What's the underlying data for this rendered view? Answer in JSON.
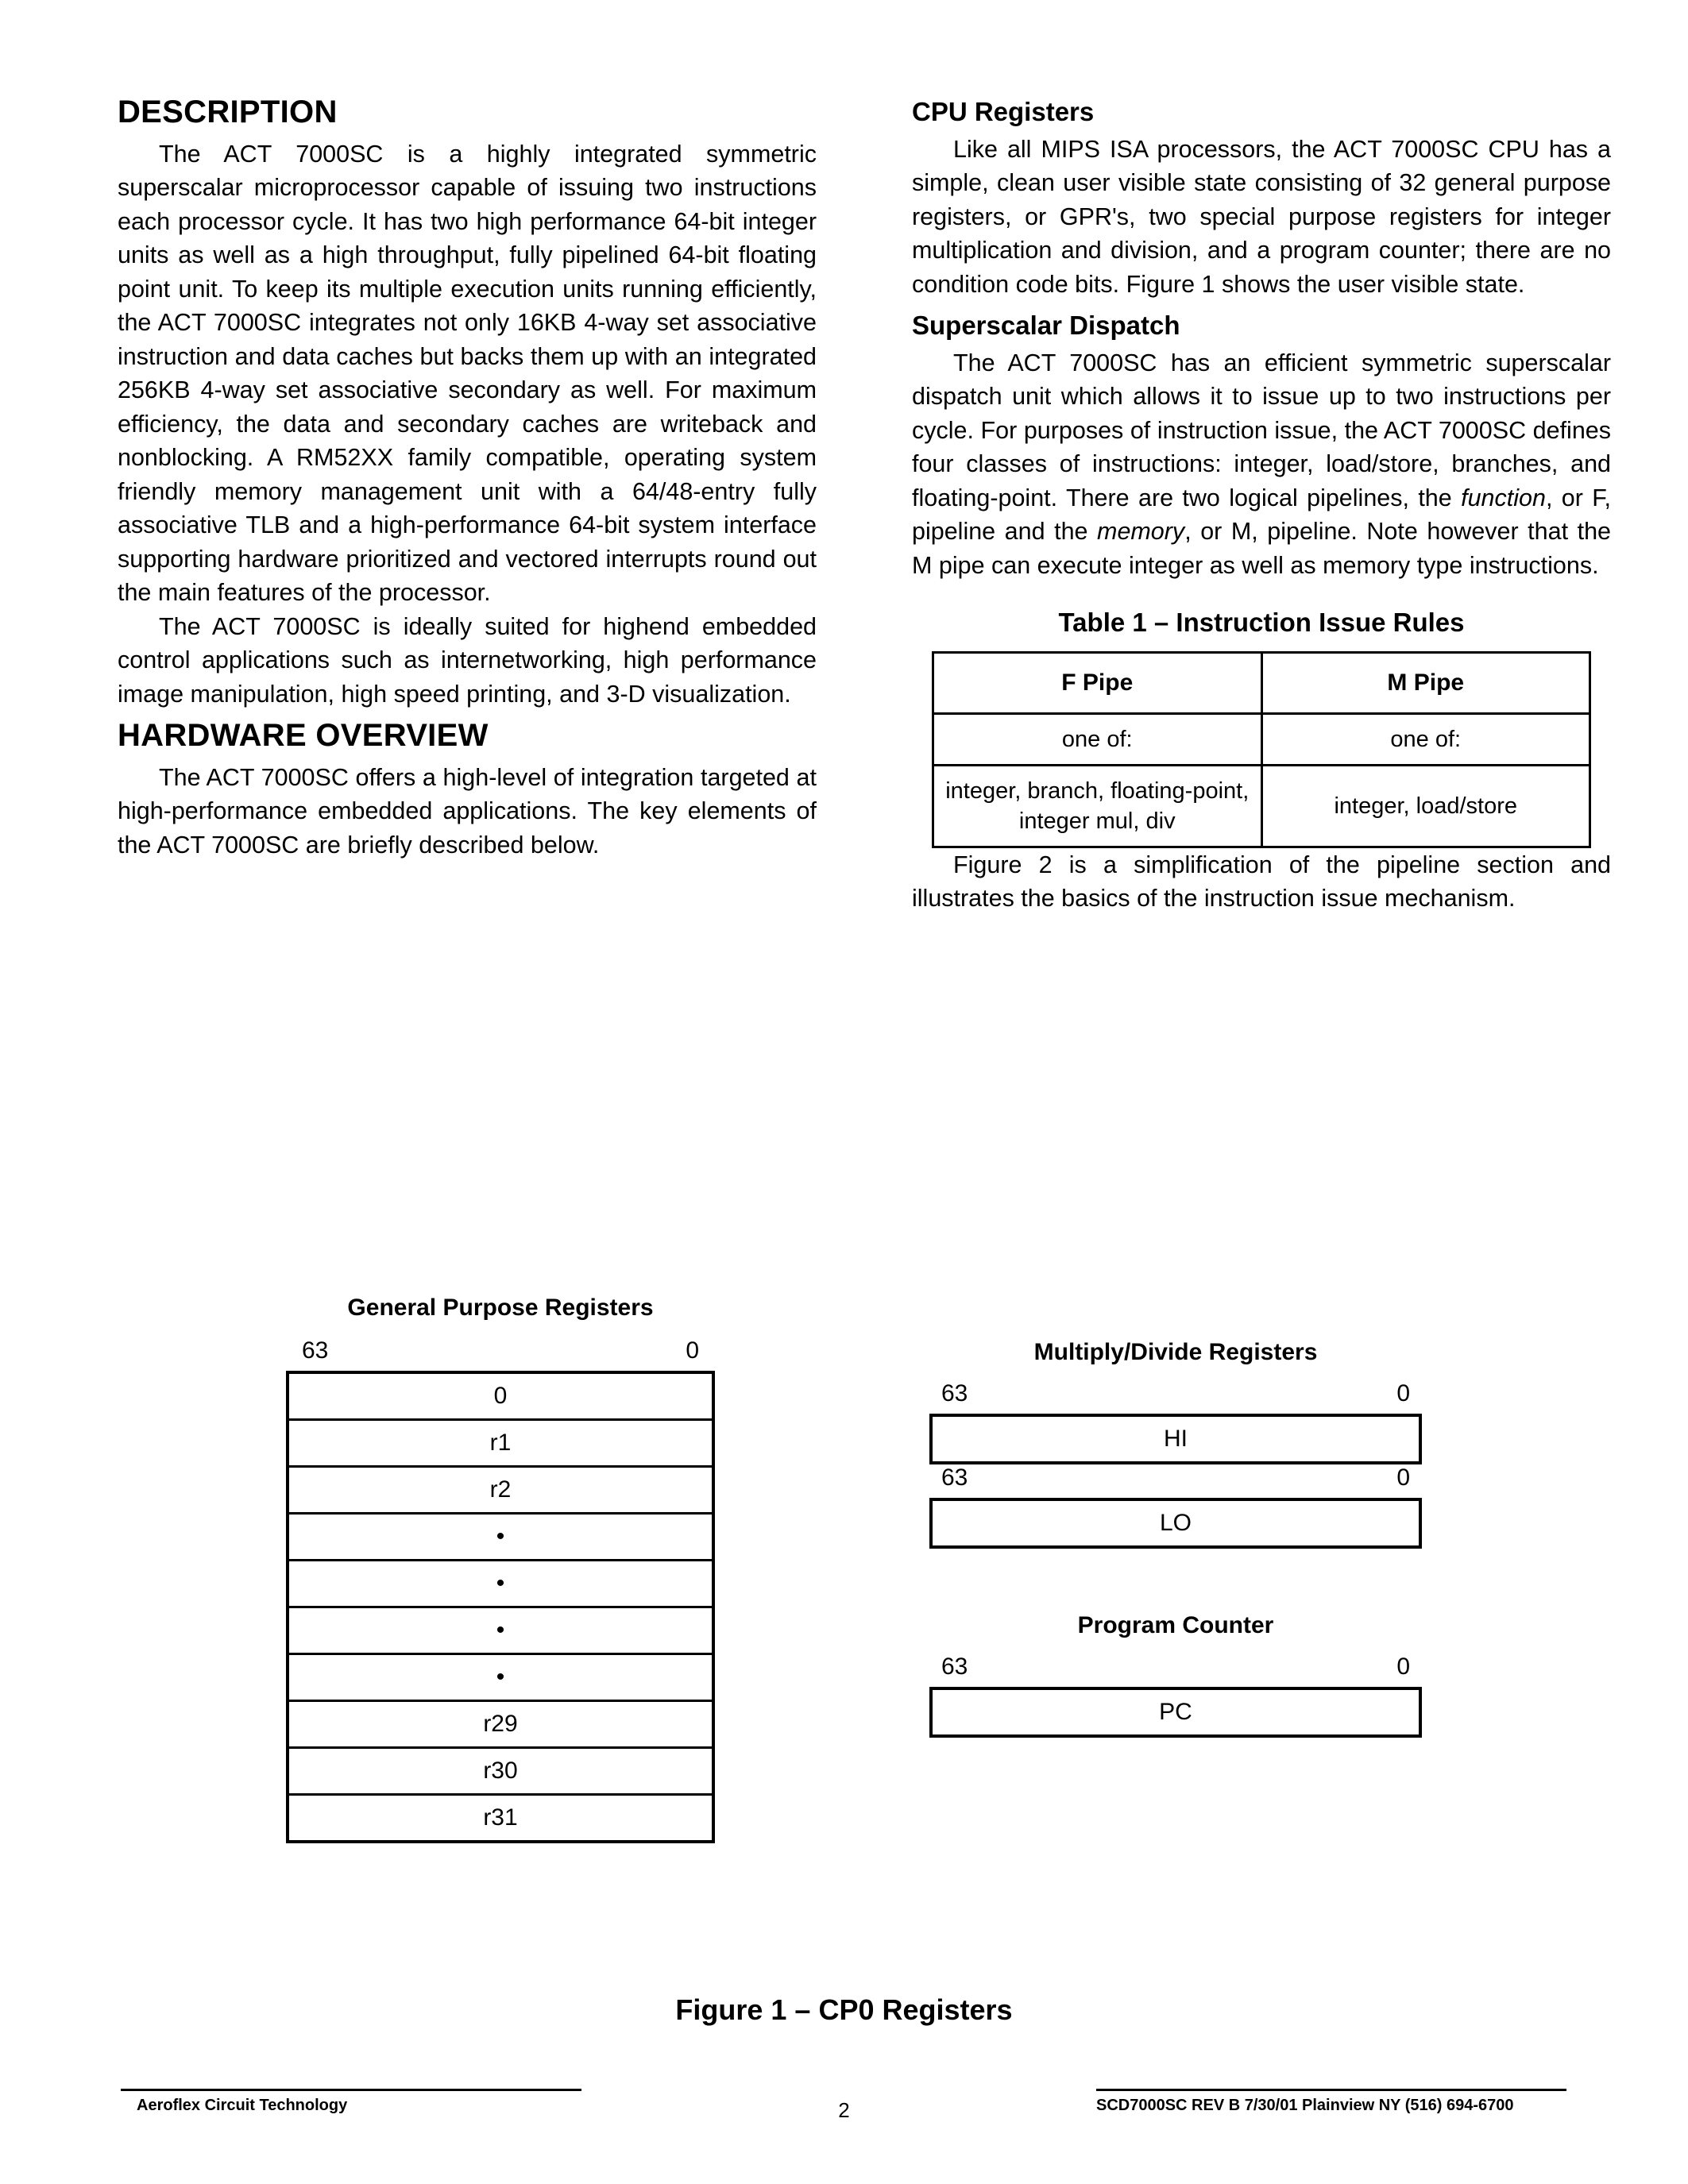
{
  "left_column": {
    "heading1": "DESCRIPTION",
    "para1": "The ACT 7000SC is a highly integrated symmetric superscalar microprocessor capable of issuing two instructions each processor cycle. It has two high performance 64-bit integer units as well as a high throughput, fully pipelined 64-bit floating point unit. To keep its multiple execution units running efficiently, the ACT 7000SC integrates not only 16KB 4-way set associative instruction and data caches but backs them up with an integrated 256KB 4-way set associative secondary as well. For maximum efficiency, the data and secondary caches are writeback and nonblocking. A RM52XX family compatible, operating system friendly memory management unit with a 64/48-entry fully associative TLB and a high-performance 64-bit system interface supporting hardware prioritized and vectored interrupts round out the main features of the processor.",
    "para2": "The ACT 7000SC is ideally suited for highend embedded control applications such as internetworking, high performance image manipulation, high speed printing, and 3-D visualization.",
    "heading2": "HARDWARE OVERVIEW",
    "para3": "The ACT 7000SC offers a high-level of integration targeted at high-performance embedded applications. The key elements of the ACT 7000SC are briefly described below."
  },
  "right_column": {
    "heading1": "CPU Registers",
    "para1": "Like all MIPS ISA processors, the ACT 7000SC CPU has a simple, clean user visible state consisting of 32 general purpose registers, or GPR's, two special purpose registers for integer multiplication and division, and a program counter; there are no condition code bits. Figure 1 shows the user visible state.",
    "heading2": "Superscalar Dispatch",
    "para2_a": "The ACT 7000SC has an efficient symmetric superscalar dispatch unit which allows it to issue up to two instructions per cycle. For purposes of instruction issue, the ACT 7000SC defines four classes of instructions: integer, load/store, branches, and floating-point. There are two logical pipelines, the ",
    "para2_em1": "function",
    "para2_b": ", or F, pipeline and the ",
    "para2_em2": "memory",
    "para2_c": ", or M, pipeline. Note however that the M pipe can execute integer as well as memory type instructions.",
    "table_title": "Table 1 – Instruction Issue Rules",
    "table": {
      "headers": [
        "F Pipe",
        "M Pipe"
      ],
      "rows": [
        [
          "one of:",
          "one of:"
        ],
        [
          "integer, branch, floating-point, integer mul, div",
          "integer, load/store"
        ]
      ]
    },
    "para3": "Figure 2 is a simplification of the pipeline section and illustrates the basics of the instruction issue mechanism."
  },
  "figure": {
    "gpr": {
      "title": "General Purpose Registers",
      "bit_high": "63",
      "bit_low": "0",
      "rows": [
        "0",
        "r1",
        "r2",
        "•",
        "•",
        "•",
        "•",
        "r29",
        "r30",
        "r31"
      ]
    },
    "muldiv": {
      "title": "Multiply/Divide Registers",
      "bit_high_1": "63",
      "bit_low_1": "0",
      "row_hi": "HI",
      "bit_high_2": "63",
      "bit_low_2": "0",
      "row_lo": "LO"
    },
    "pc": {
      "title": "Program Counter",
      "bit_high": "63",
      "bit_low": "0",
      "row_pc": "PC"
    },
    "caption": "Figure 1 – CP0 Registers"
  },
  "footer": {
    "left": "Aeroflex Circuit Technology",
    "page": "2",
    "right": "SCD7000SC REV B  7/30/01 Plainview NY (516) 694-6700"
  }
}
